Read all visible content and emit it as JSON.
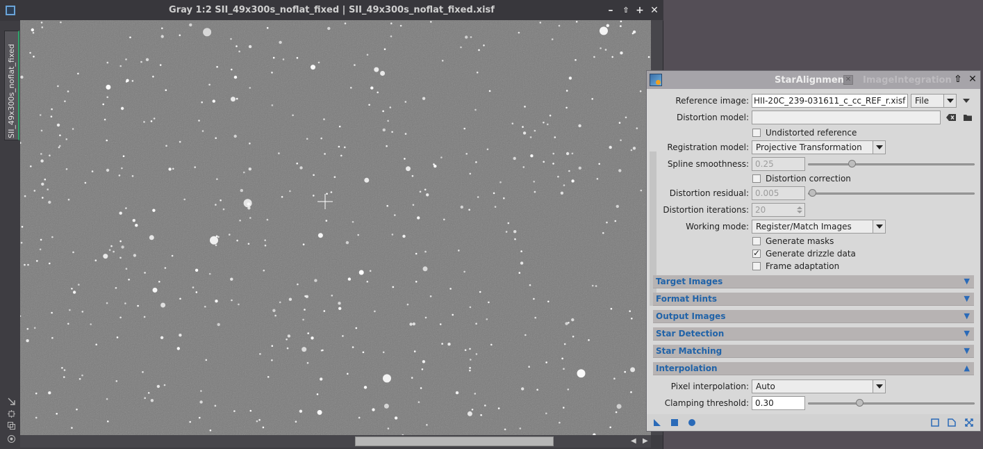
{
  "image_window": {
    "title": "Gray 1:2 SII_49x300s_noflat_fixed | SII_49x300s_noflat_fixed.xisf",
    "tab_label": "SII_49x300s_noflat_fixed"
  },
  "tool": {
    "title": "StarAlignment",
    "secondary_title": "ImageIntegration",
    "reference_image": {
      "label": "Reference image:",
      "value": "HII-20C_239-031611_c_cc_REF_r.xisf",
      "mode": "File"
    },
    "distortion_model": {
      "label": "Distortion model:",
      "value": ""
    },
    "undistorted_reference": {
      "label": "Undistorted reference",
      "checked": false
    },
    "registration_model": {
      "label": "Registration model:",
      "value": "Projective Transformation"
    },
    "spline_smoothness": {
      "label": "Spline smoothness:",
      "value": "0.25",
      "level": 0.25
    },
    "distortion_correction": {
      "label": "Distortion correction",
      "checked": false
    },
    "distortion_residual": {
      "label": "Distortion residual:",
      "value": "0.005",
      "level": 0.0
    },
    "distortion_iterations": {
      "label": "Distortion iterations:",
      "value": "20"
    },
    "working_mode": {
      "label": "Working mode:",
      "value": "Register/Match Images"
    },
    "generate_masks": {
      "label": "Generate masks",
      "checked": false
    },
    "generate_drizzle": {
      "label": "Generate drizzle data",
      "checked": true
    },
    "frame_adaptation": {
      "label": "Frame adaptation",
      "checked": false
    },
    "sections": [
      {
        "label": "Target Images",
        "expanded": false
      },
      {
        "label": "Format Hints",
        "expanded": false
      },
      {
        "label": "Output Images",
        "expanded": false
      },
      {
        "label": "Star Detection",
        "expanded": false
      },
      {
        "label": "Star Matching",
        "expanded": false
      },
      {
        "label": "Interpolation",
        "expanded": true
      }
    ],
    "pixel_interpolation": {
      "label": "Pixel interpolation:",
      "value": "Auto"
    },
    "clamping_threshold": {
      "label": "Clamping threshold:",
      "value": "0.30",
      "level": 0.3
    }
  },
  "colors": {
    "section_text": "#2163a8",
    "accent_green": "#2ea46a"
  }
}
